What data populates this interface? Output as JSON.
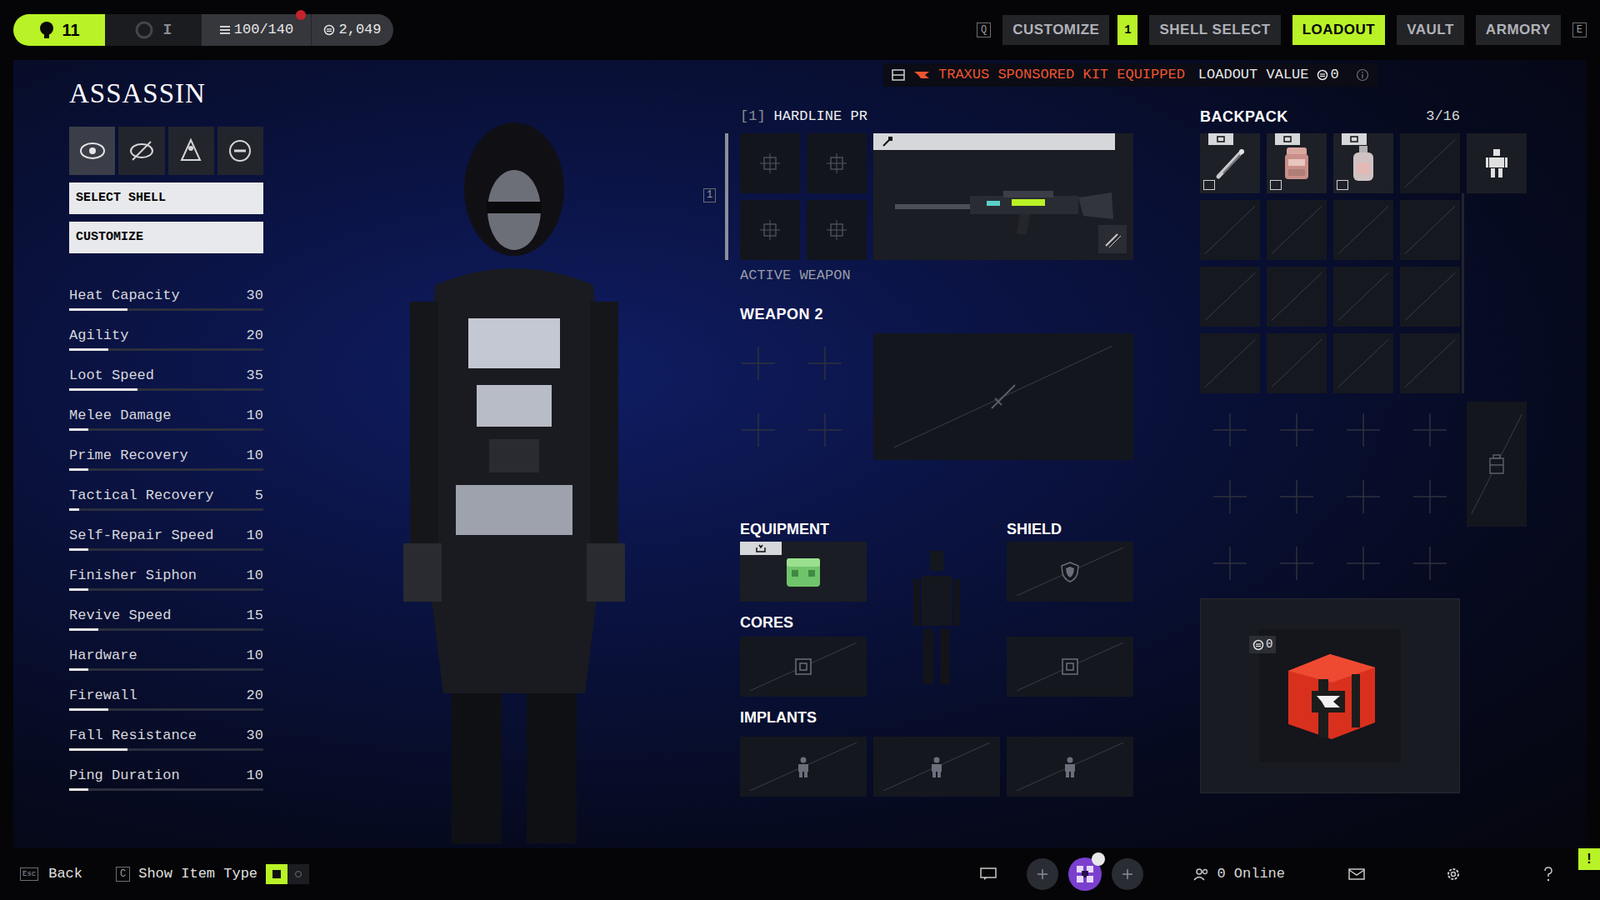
{
  "topbar": {
    "level": "11",
    "rank": "I",
    "capacity": "100/140",
    "capacity_alert": true,
    "credits": "2,049"
  },
  "nav": {
    "left_key": "Q",
    "right_key": "E",
    "items": [
      {
        "label": "CUSTOMIZE",
        "selected": false,
        "badge": "1"
      },
      {
        "label": "SHELL SELECT",
        "selected": false,
        "badge": ""
      },
      {
        "label": "LOADOUT",
        "selected": true,
        "badge": ""
      },
      {
        "label": "VAULT",
        "selected": false,
        "badge": ""
      },
      {
        "label": "ARMORY",
        "selected": false,
        "badge": ""
      }
    ]
  },
  "sponsor": {
    "text": "TRAXUS SPONSORED KIT EQUIPPED",
    "value_label": "LOADOUT VALUE",
    "value": "0"
  },
  "shell": {
    "name": "ASSASSIN",
    "icon_tabs": [
      {
        "selected": true
      },
      {
        "selected": false
      },
      {
        "selected": false
      },
      {
        "selected": false
      }
    ],
    "buttons": [
      "SELECT SHELL",
      "CUSTOMIZE"
    ],
    "stats": [
      {
        "label": "Heat Capacity",
        "value": "30",
        "level": 0.3
      },
      {
        "label": "Agility",
        "value": "20",
        "level": 0.2
      },
      {
        "label": "Loot Speed",
        "value": "35",
        "level": 0.35
      },
      {
        "label": "Melee Damage",
        "value": "10",
        "level": 0.1
      },
      {
        "label": "Prime Recovery",
        "value": "10",
        "level": 0.1
      },
      {
        "label": "Tactical Recovery",
        "value": "5",
        "level": 0.05
      },
      {
        "label": "Self-Repair Speed",
        "value": "10",
        "level": 0.1
      },
      {
        "label": "Finisher Siphon",
        "value": "10",
        "level": 0.1
      },
      {
        "label": "Revive Speed",
        "value": "15",
        "level": 0.15
      },
      {
        "label": "Hardware",
        "value": "10",
        "level": 0.1
      },
      {
        "label": "Firewall",
        "value": "20",
        "level": 0.2
      },
      {
        "label": "Fall Resistance",
        "value": "30",
        "level": 0.3
      },
      {
        "label": "Ping Duration",
        "value": "10",
        "level": 0.1
      }
    ]
  },
  "weapon": {
    "slot": "[1]",
    "name": "HARDLINE PR",
    "key": "1",
    "status": "ACTIVE WEAPON"
  },
  "weapon2": {
    "title": "WEAPON 2"
  },
  "equipment": {
    "title": "EQUIPMENT",
    "filled": true
  },
  "shield": {
    "title": "SHIELD",
    "filled": false
  },
  "cores": {
    "title": "CORES",
    "slots": [
      {
        "filled": false
      },
      {
        "filled": false
      }
    ]
  },
  "implants": {
    "title": "IMPLANTS",
    "slots": [
      {
        "filled": false
      },
      {
        "filled": false
      },
      {
        "filled": false
      }
    ]
  },
  "backpack": {
    "title": "BACKPACK",
    "count": "3/16",
    "cells": [
      {
        "kind": "tool"
      },
      {
        "kind": "pack"
      },
      {
        "kind": "flask"
      },
      {
        "kind": "empty"
      },
      {
        "kind": "empty"
      },
      {
        "kind": "empty"
      },
      {
        "kind": "empty"
      },
      {
        "kind": "empty"
      },
      {
        "kind": "empty"
      },
      {
        "kind": "empty"
      },
      {
        "kind": "empty"
      },
      {
        "kind": "empty"
      },
      {
        "kind": "empty"
      },
      {
        "kind": "empty"
      },
      {
        "kind": "empty"
      },
      {
        "kind": "empty"
      }
    ],
    "locked_slots": 12
  },
  "kit": {
    "value": "0"
  },
  "bottombar": {
    "back_key": "Esc",
    "back": "Back",
    "toggle_key": "C",
    "toggle_label": "Show Item Type",
    "toggle_on": true,
    "online": "0 Online",
    "alert": "!"
  }
}
